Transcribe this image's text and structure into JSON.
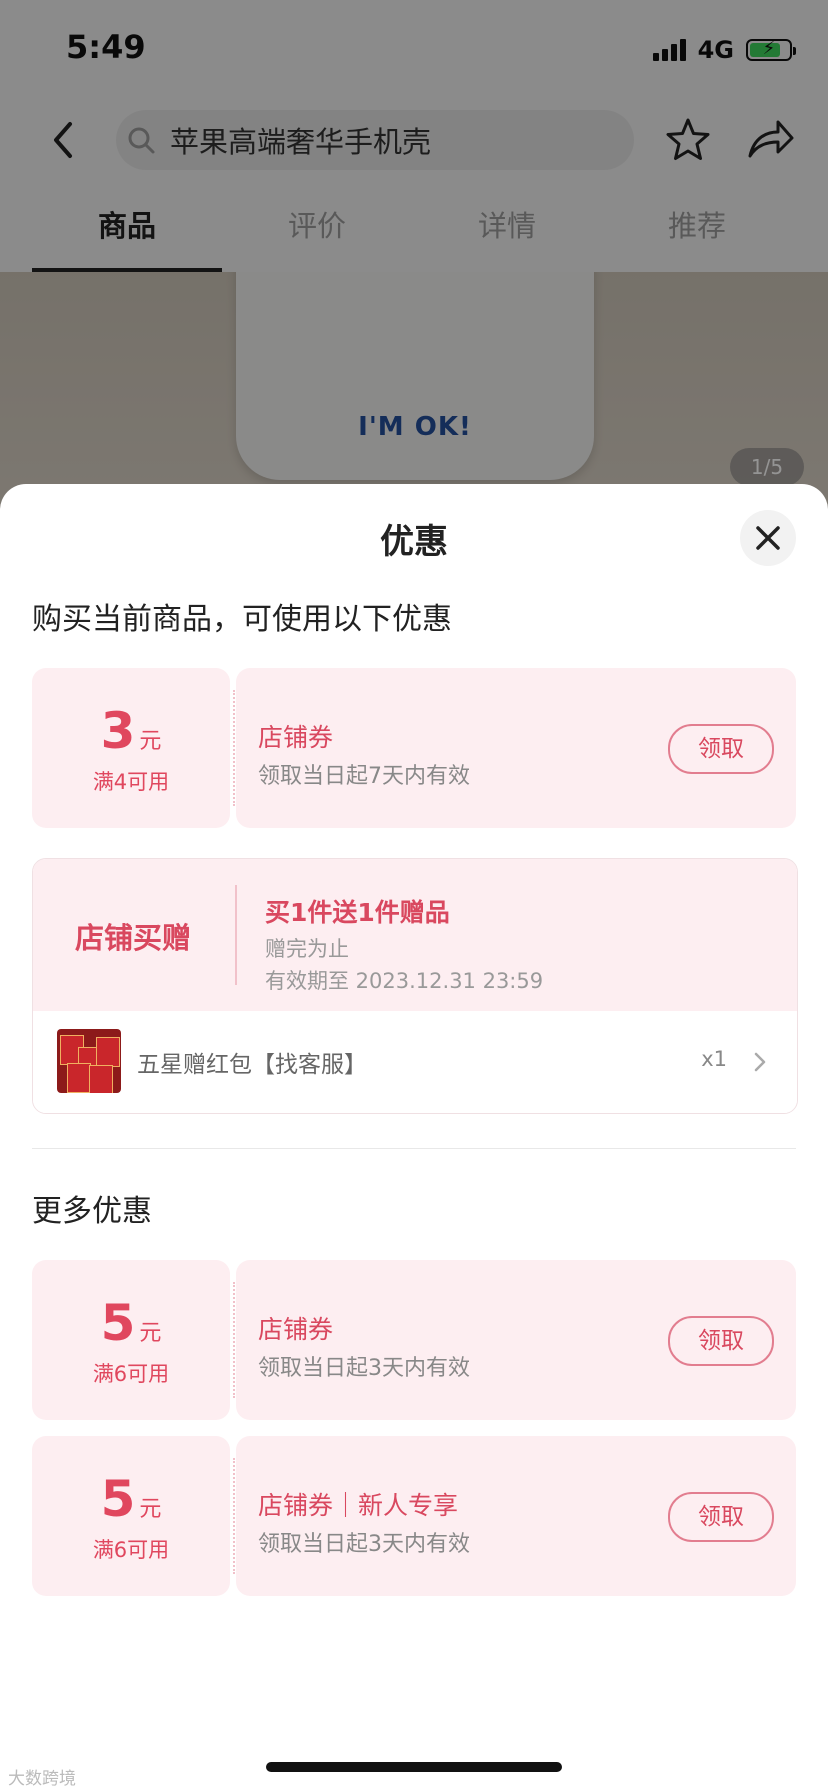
{
  "status_bar": {
    "time": "5:49",
    "network": "4G",
    "battery_level": 0.8
  },
  "nav": {
    "search_text": "苹果高端奢华手机壳"
  },
  "tabs": [
    {
      "label": "商品",
      "active": true
    },
    {
      "label": "评价",
      "active": false
    },
    {
      "label": "详情",
      "active": false
    },
    {
      "label": "推荐",
      "active": false
    }
  ],
  "product": {
    "case_text": "I'M OK!",
    "page_indicator": "1/5"
  },
  "sheet": {
    "title": "优惠",
    "current_section_title": "购买当前商品，可使用以下优惠",
    "more_section_title": "更多优惠"
  },
  "coupons": [
    {
      "amount": "3",
      "unit": "元",
      "condition": "满4可用",
      "name": "店铺券",
      "desc": "领取当日起7天内有效",
      "button": "领取"
    },
    {
      "amount": "5",
      "unit": "元",
      "condition": "满6可用",
      "name": "店铺券",
      "desc": "领取当日起3天内有效",
      "button": "领取"
    },
    {
      "amount": "5",
      "unit": "元",
      "condition": "满6可用",
      "name": "店铺券｜新人专享",
      "desc": "领取当日起3天内有效",
      "button": "领取"
    }
  ],
  "gift": {
    "label": "店铺买赠",
    "title": "买1件送1件赠品",
    "stock_note": "赠完为止",
    "expire": "有效期至 2023.12.31 23:59",
    "item_name": "五星赠红包【找客服】",
    "qty": "x1"
  },
  "watermark": "大数跨境",
  "colors": {
    "accent": "#d9485f",
    "coupon_bg": "#fdeef1",
    "battery": "#3dd35c"
  }
}
